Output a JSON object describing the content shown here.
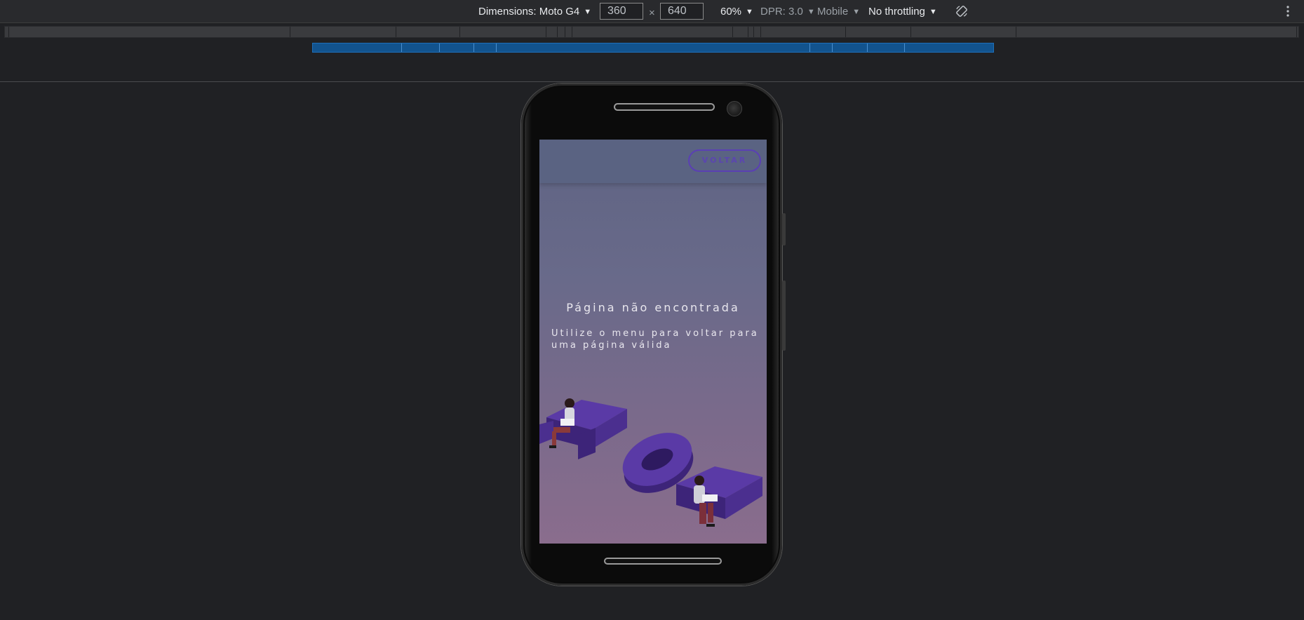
{
  "toolbar": {
    "dimensions_label": "Dimensions: Moto G4",
    "width_value": "360",
    "height_value": "640",
    "times": "×",
    "zoom": "60%",
    "dpr": "DPR: 3.0",
    "device_type": "Mobile",
    "throttling": "No throttling",
    "rotate_icon": "rotate-icon",
    "more_icon": "more-vert-icon"
  },
  "site": {
    "back_button": "VOLTAR",
    "title": "Página não encontrada",
    "message": "Utilize o menu para voltar para uma página válida",
    "illustration": "404-illustration",
    "colors": {
      "accent": "#5a3fb4",
      "illustration_purple": "#4b2f8f"
    }
  }
}
